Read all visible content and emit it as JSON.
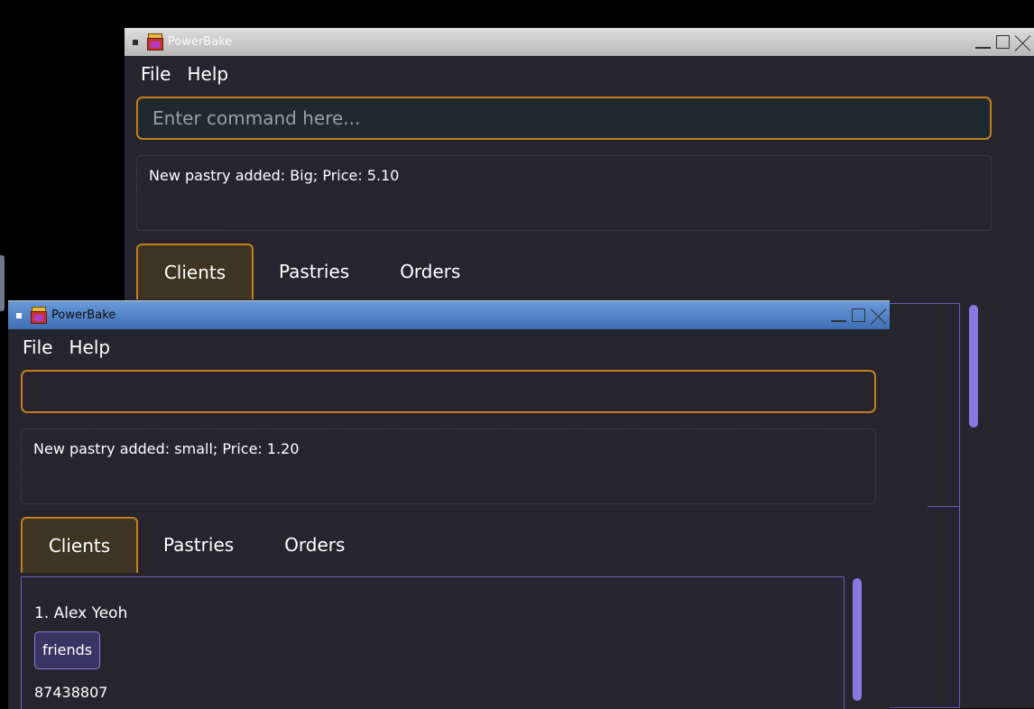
{
  "back_window": {
    "title": "PowerBake",
    "menu": [
      "File",
      "Help"
    ],
    "command_placeholder": "Enter command here...",
    "result_text": "New pastry added: Big; Price: 5.10",
    "tabs": [
      "Clients",
      "Pastries",
      "Orders"
    ],
    "active_tab": "Clients"
  },
  "front_window": {
    "title": "PowerBake",
    "menu": [
      "File",
      "Help"
    ],
    "command_value": "",
    "result_text": "New pastry added: small; Price: 1.20",
    "tabs": [
      "Clients",
      "Pastries",
      "Orders"
    ],
    "active_tab": "Clients",
    "clients": [
      {
        "name": "1. Alex Yeoh",
        "tags": [
          "friends"
        ],
        "phone": "87438807"
      }
    ]
  },
  "colors": {
    "background": "#26252d",
    "accent": "#c47f1d",
    "list_border": "#6e5bc0",
    "scrollbar": "#8779e0"
  }
}
